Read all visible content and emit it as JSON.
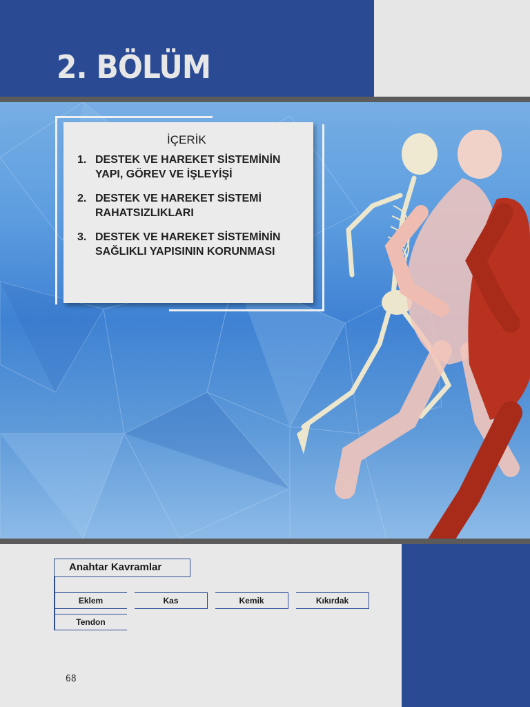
{
  "chapter": {
    "title": "2. BÖLÜM"
  },
  "contents": {
    "heading": "İÇERİK",
    "items": [
      {
        "num": "1.",
        "text": "DESTEK VE HAREKET SİSTEMİNİN YAPI, GÖREV VE İŞLEYİŞİ"
      },
      {
        "num": "2.",
        "text": "DESTEK VE HAREKET SİSTEMİ RAHATSIZLIKLARI"
      },
      {
        "num": "3.",
        "text": "DESTEK VE HAREKET SİSTEMİNİN SAĞLIKLI YAPISININ KORUNMASI"
      }
    ]
  },
  "key_concepts": {
    "title": "Anahtar Kavramlar",
    "terms": [
      "Eklem",
      "Kas",
      "Kemik",
      "Kıkırdak",
      "Tendon"
    ]
  },
  "page_number": "68",
  "colors": {
    "brand_blue": "#2a4a94",
    "band_grey": "#5b5b5b",
    "page_bg": "#e8e8e8"
  }
}
